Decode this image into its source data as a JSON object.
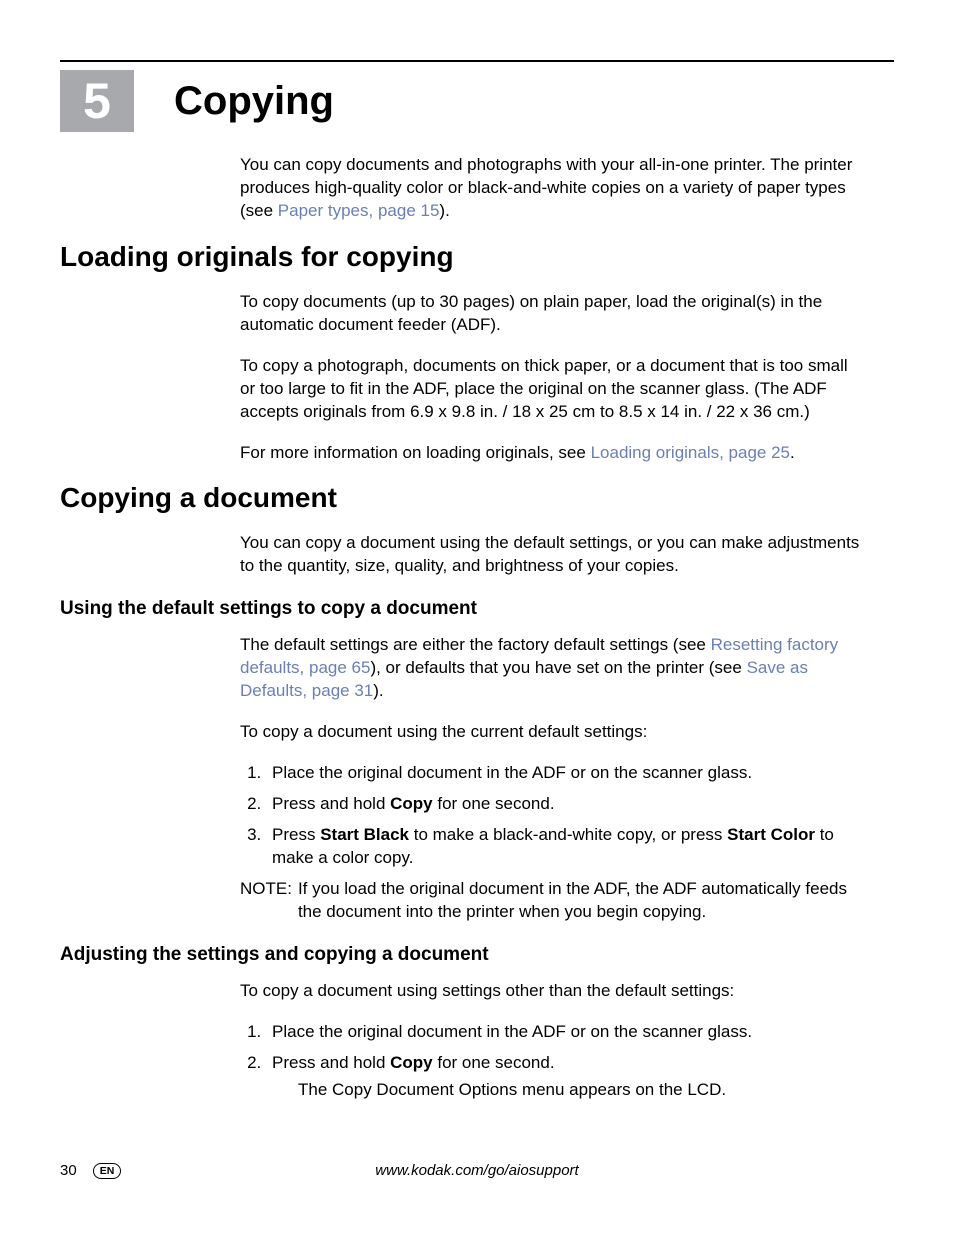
{
  "chapter": {
    "number": "5",
    "title": "Copying"
  },
  "intro": {
    "text1": "You can copy documents and photographs with your all-in-one printer. The printer produces high-quality color or black-and-white copies on a variety of paper types (see ",
    "link1": "Paper types, page 15",
    "text2": ")."
  },
  "section1": {
    "title": "Loading originals for copying",
    "p1": "To copy documents (up to 30 pages) on plain paper, load the original(s) in the automatic document feeder (ADF).",
    "p2": "To copy a photograph, documents on thick paper, or a document that is too small or too large to fit in the ADF, place the original on the scanner glass. (The ADF accepts originals from 6.9 x 9.8 in. / 18 x 25 cm to 8.5 x 14 in. / 22 x 36 cm.)",
    "p3a": "For more information on loading originals, see ",
    "p3link": "Loading originals, page 25",
    "p3b": "."
  },
  "section2": {
    "title": "Copying a document",
    "p1": "You can copy a document using the default settings, or you can make adjustments to the quantity, size, quality, and brightness of your copies."
  },
  "sub1": {
    "title": "Using the default settings to copy a document",
    "p1a": "The default settings are either the factory default settings (see ",
    "link1": "Resetting factory defaults, page 65",
    "p1b": "), or defaults that you have set on the printer (see ",
    "link2": "Save as Defaults, page 31",
    "p1c": ").",
    "p2": "To copy a document using the current default settings:",
    "steps": {
      "s1": "Place the original document in the ADF or on the scanner glass.",
      "s2a": "Press and hold ",
      "s2bold": "Copy",
      "s2b": " for one second.",
      "s3a": "Press ",
      "s3bold1": "Start Black",
      "s3b": " to make a black-and-white copy, or press ",
      "s3bold2": "Start Color",
      "s3c": " to make a color copy."
    },
    "note_label": "NOTE:",
    "note_text": "If you load the original document in the ADF, the ADF automatically feeds the document into the printer when you begin copying."
  },
  "sub2": {
    "title": "Adjusting the settings and copying a document",
    "p1": "To copy a document using settings other than the default settings:",
    "steps": {
      "s1": "Place the original document in the ADF or on the scanner glass.",
      "s2a": "Press and hold ",
      "s2bold": "Copy",
      "s2b": " for one second.",
      "s2sub": "The Copy Document Options menu appears on the LCD."
    }
  },
  "footer": {
    "page": "30",
    "lang": "EN",
    "url": "www.kodak.com/go/aiosupport"
  }
}
